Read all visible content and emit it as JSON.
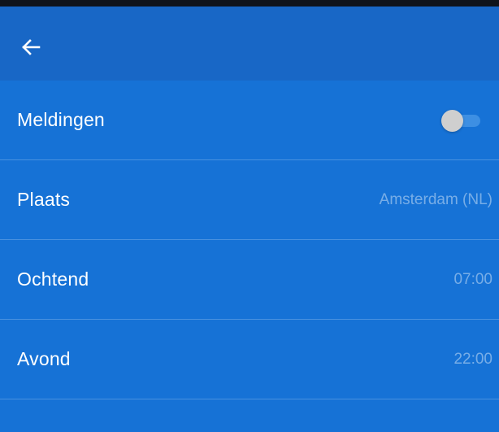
{
  "appbar": {
    "back_icon": "arrow-left-icon"
  },
  "settings": [
    {
      "id": "meldingen",
      "label": "Meldingen",
      "control": "toggle",
      "enabled": false
    },
    {
      "id": "plaats",
      "label": "Plaats",
      "value": "Amsterdam (NL)"
    },
    {
      "id": "ochtend",
      "label": "Ochtend",
      "value": "07:00"
    },
    {
      "id": "avond",
      "label": "Avond",
      "value": "22:00"
    }
  ],
  "colors": {
    "background": "#1672d6",
    "appbar": "#1867c6",
    "toggle_track": "#3d8fe3",
    "toggle_thumb": "#cfcfcf"
  }
}
